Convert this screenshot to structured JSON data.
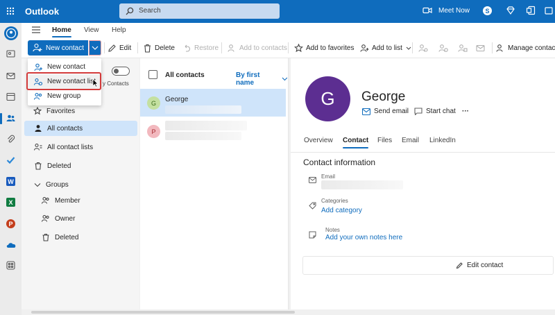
{
  "app": {
    "title": "Outlook"
  },
  "search": {
    "placeholder": "Search"
  },
  "topbar": {
    "meet_now": "Meet Now"
  },
  "ribbon": {
    "tabs": [
      {
        "label": "Home",
        "selected": true
      },
      {
        "label": "View",
        "selected": false
      },
      {
        "label": "Help",
        "selected": false
      }
    ],
    "new_contact": "New contact",
    "edit": "Edit",
    "delete": "Delete",
    "restore": "Restore",
    "add_to_contacts": "Add to contacts",
    "add_to_favorites": "Add to favorites",
    "add_to_list": "Add to list",
    "manage_contacts": "Manage contacts"
  },
  "dropdown": {
    "items": [
      "New contact",
      "New contact list",
      "New group"
    ],
    "highlighted_index": 1
  },
  "nav": {
    "behind_text": "y Contacts",
    "favorites": "Favorites",
    "all_contacts": "All contacts",
    "all_contact_lists": "All contact lists",
    "deleted": "Deleted",
    "groups": "Groups",
    "member": "Member",
    "owner": "Owner",
    "groups_deleted": "Deleted"
  },
  "list": {
    "title": "All contacts",
    "sort": "By first name",
    "contacts": [
      {
        "initial": "G",
        "name": "George",
        "color": "#c4e0a0",
        "text_color": "#3a6b1a"
      },
      {
        "initial": "P",
        "name": "",
        "color": "#f2b8be",
        "text_color": "#a4262c"
      }
    ]
  },
  "details": {
    "initial": "G",
    "name": "George",
    "avatar_color": "#5c2e91",
    "send_email": "Send email",
    "start_chat": "Start chat",
    "more": "···",
    "tabs": [
      "Overview",
      "Contact",
      "Files",
      "Email",
      "LinkedIn"
    ],
    "selected_tab": "Contact",
    "section_title": "Contact information",
    "email_label": "Email",
    "categories_label": "Categories",
    "add_category": "Add category",
    "notes_label": "Notes",
    "add_notes": "Add your own notes here",
    "edit_contact": "Edit contact"
  },
  "colors": {
    "brand": "#0f6cbd",
    "highlight": "#d33a3a",
    "selected_bg": "#cfe4fa"
  }
}
